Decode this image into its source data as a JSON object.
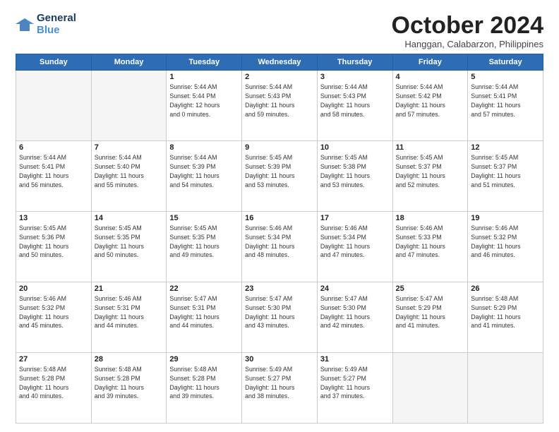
{
  "header": {
    "logo_line1": "General",
    "logo_line2": "Blue",
    "month": "October 2024",
    "location": "Hanggan, Calabarzon, Philippines"
  },
  "weekdays": [
    "Sunday",
    "Monday",
    "Tuesday",
    "Wednesday",
    "Thursday",
    "Friday",
    "Saturday"
  ],
  "weeks": [
    [
      {
        "day": "",
        "info": ""
      },
      {
        "day": "",
        "info": ""
      },
      {
        "day": "1",
        "info": "Sunrise: 5:44 AM\nSunset: 5:44 PM\nDaylight: 12 hours\nand 0 minutes."
      },
      {
        "day": "2",
        "info": "Sunrise: 5:44 AM\nSunset: 5:43 PM\nDaylight: 11 hours\nand 59 minutes."
      },
      {
        "day": "3",
        "info": "Sunrise: 5:44 AM\nSunset: 5:43 PM\nDaylight: 11 hours\nand 58 minutes."
      },
      {
        "day": "4",
        "info": "Sunrise: 5:44 AM\nSunset: 5:42 PM\nDaylight: 11 hours\nand 57 minutes."
      },
      {
        "day": "5",
        "info": "Sunrise: 5:44 AM\nSunset: 5:41 PM\nDaylight: 11 hours\nand 57 minutes."
      }
    ],
    [
      {
        "day": "6",
        "info": "Sunrise: 5:44 AM\nSunset: 5:41 PM\nDaylight: 11 hours\nand 56 minutes."
      },
      {
        "day": "7",
        "info": "Sunrise: 5:44 AM\nSunset: 5:40 PM\nDaylight: 11 hours\nand 55 minutes."
      },
      {
        "day": "8",
        "info": "Sunrise: 5:44 AM\nSunset: 5:39 PM\nDaylight: 11 hours\nand 54 minutes."
      },
      {
        "day": "9",
        "info": "Sunrise: 5:45 AM\nSunset: 5:39 PM\nDaylight: 11 hours\nand 53 minutes."
      },
      {
        "day": "10",
        "info": "Sunrise: 5:45 AM\nSunset: 5:38 PM\nDaylight: 11 hours\nand 53 minutes."
      },
      {
        "day": "11",
        "info": "Sunrise: 5:45 AM\nSunset: 5:37 PM\nDaylight: 11 hours\nand 52 minutes."
      },
      {
        "day": "12",
        "info": "Sunrise: 5:45 AM\nSunset: 5:37 PM\nDaylight: 11 hours\nand 51 minutes."
      }
    ],
    [
      {
        "day": "13",
        "info": "Sunrise: 5:45 AM\nSunset: 5:36 PM\nDaylight: 11 hours\nand 50 minutes."
      },
      {
        "day": "14",
        "info": "Sunrise: 5:45 AM\nSunset: 5:35 PM\nDaylight: 11 hours\nand 50 minutes."
      },
      {
        "day": "15",
        "info": "Sunrise: 5:45 AM\nSunset: 5:35 PM\nDaylight: 11 hours\nand 49 minutes."
      },
      {
        "day": "16",
        "info": "Sunrise: 5:46 AM\nSunset: 5:34 PM\nDaylight: 11 hours\nand 48 minutes."
      },
      {
        "day": "17",
        "info": "Sunrise: 5:46 AM\nSunset: 5:34 PM\nDaylight: 11 hours\nand 47 minutes."
      },
      {
        "day": "18",
        "info": "Sunrise: 5:46 AM\nSunset: 5:33 PM\nDaylight: 11 hours\nand 47 minutes."
      },
      {
        "day": "19",
        "info": "Sunrise: 5:46 AM\nSunset: 5:32 PM\nDaylight: 11 hours\nand 46 minutes."
      }
    ],
    [
      {
        "day": "20",
        "info": "Sunrise: 5:46 AM\nSunset: 5:32 PM\nDaylight: 11 hours\nand 45 minutes."
      },
      {
        "day": "21",
        "info": "Sunrise: 5:46 AM\nSunset: 5:31 PM\nDaylight: 11 hours\nand 44 minutes."
      },
      {
        "day": "22",
        "info": "Sunrise: 5:47 AM\nSunset: 5:31 PM\nDaylight: 11 hours\nand 44 minutes."
      },
      {
        "day": "23",
        "info": "Sunrise: 5:47 AM\nSunset: 5:30 PM\nDaylight: 11 hours\nand 43 minutes."
      },
      {
        "day": "24",
        "info": "Sunrise: 5:47 AM\nSunset: 5:30 PM\nDaylight: 11 hours\nand 42 minutes."
      },
      {
        "day": "25",
        "info": "Sunrise: 5:47 AM\nSunset: 5:29 PM\nDaylight: 11 hours\nand 41 minutes."
      },
      {
        "day": "26",
        "info": "Sunrise: 5:48 AM\nSunset: 5:29 PM\nDaylight: 11 hours\nand 41 minutes."
      }
    ],
    [
      {
        "day": "27",
        "info": "Sunrise: 5:48 AM\nSunset: 5:28 PM\nDaylight: 11 hours\nand 40 minutes."
      },
      {
        "day": "28",
        "info": "Sunrise: 5:48 AM\nSunset: 5:28 PM\nDaylight: 11 hours\nand 39 minutes."
      },
      {
        "day": "29",
        "info": "Sunrise: 5:48 AM\nSunset: 5:28 PM\nDaylight: 11 hours\nand 39 minutes."
      },
      {
        "day": "30",
        "info": "Sunrise: 5:49 AM\nSunset: 5:27 PM\nDaylight: 11 hours\nand 38 minutes."
      },
      {
        "day": "31",
        "info": "Sunrise: 5:49 AM\nSunset: 5:27 PM\nDaylight: 11 hours\nand 37 minutes."
      },
      {
        "day": "",
        "info": ""
      },
      {
        "day": "",
        "info": ""
      }
    ]
  ]
}
